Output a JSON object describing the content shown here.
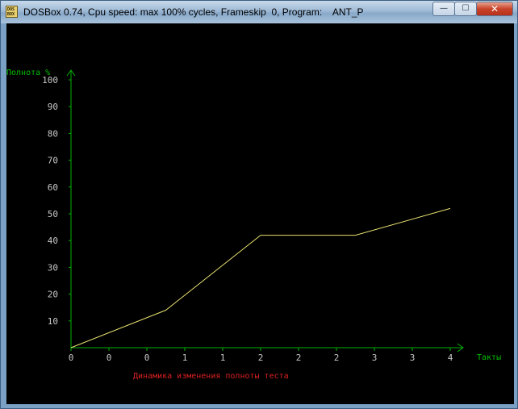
{
  "window": {
    "title": "DOSBox 0.74, Cpu speed: max 100% cycles, Frameskip  0, Program:    ANT_P",
    "minimize_glyph": "—",
    "maximize_glyph": "☐",
    "close_glyph": "✕"
  },
  "colors": {
    "axis": "#00b000",
    "axis_label": "#00c000",
    "tick_label": "#c8c8c8",
    "line": "#e8e070",
    "caption": "#d82020"
  },
  "chart_data": {
    "type": "line",
    "ylabel": "Полнота %",
    "xlabel": "Такты",
    "title": "Динамика изменения полноты теста",
    "ylim": [
      0,
      100
    ],
    "y_ticks": [
      "10",
      "20",
      "30",
      "40",
      "50",
      "60",
      "70",
      "80",
      "90",
      "100"
    ],
    "x_ticks": [
      "0",
      "0",
      "0",
      "1",
      "1",
      "2",
      "2",
      "2",
      "3",
      "3",
      "4"
    ],
    "x": [
      0,
      1.25,
      2.5,
      3.75,
      5.0
    ],
    "values": [
      0,
      14,
      42,
      42,
      52
    ]
  }
}
